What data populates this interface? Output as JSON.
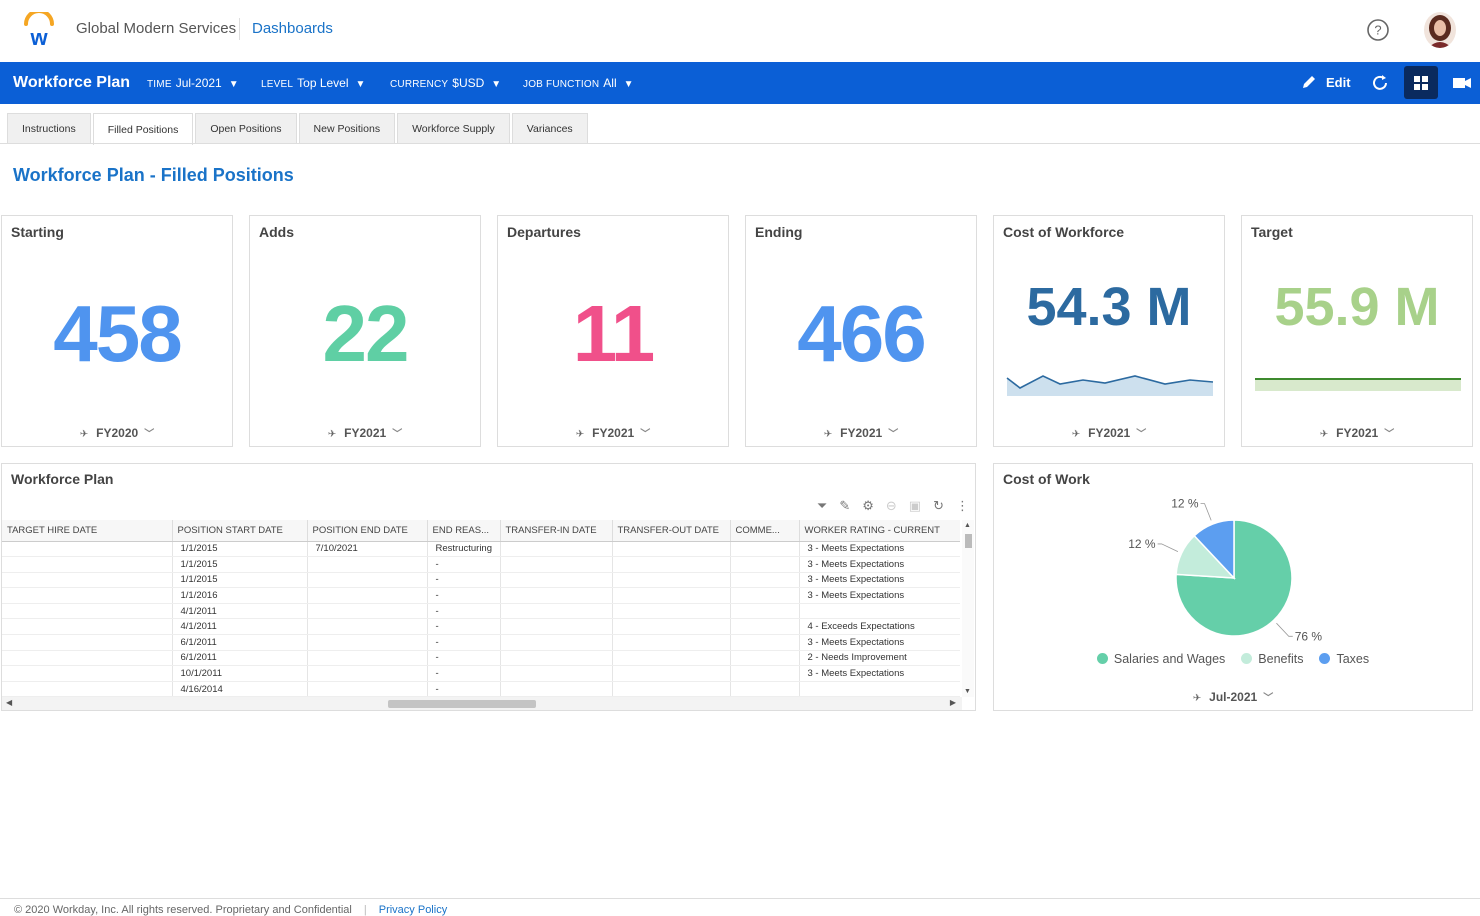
{
  "header": {
    "org_name": "Global Modern Services",
    "dashboards_link": "Dashboards"
  },
  "toolbar": {
    "title": "Workforce Plan",
    "prompts": [
      {
        "key": "TIME",
        "value": "Jul-2021"
      },
      {
        "key": "LEVEL",
        "value": "Top Level"
      },
      {
        "key": "CURRENCY",
        "value": "$USD"
      },
      {
        "key": "JOB FUNCTION",
        "value": "All"
      }
    ],
    "edit_label": "Edit"
  },
  "tabs": [
    "Instructions",
    "Filled Positions",
    "Open Positions",
    "New Positions",
    "Workforce Supply",
    "Variances"
  ],
  "active_tab": "Filled Positions",
  "page_title": "Workforce Plan - Filled Positions",
  "kpis": [
    {
      "title": "Starting",
      "value": "458",
      "period": "FY2020",
      "color": "#4f94ef"
    },
    {
      "title": "Adds",
      "value": "22",
      "period": "FY2021",
      "color": "#5fcfa4"
    },
    {
      "title": "Departures",
      "value": "11",
      "period": "FY2021",
      "color": "#f0508a"
    },
    {
      "title": "Ending",
      "value": "466",
      "period": "FY2021",
      "color": "#4f94ef"
    },
    {
      "title": "Cost of Workforce",
      "value": "54.3 M",
      "period": "FY2021",
      "color": "#2c6aa0"
    },
    {
      "title": "Target",
      "value": "55.9 M",
      "period": "FY2021",
      "color": "#a8d18a"
    }
  ],
  "workforce_plan": {
    "title": "Workforce Plan",
    "columns": [
      "TARGET HIRE DATE",
      "POSITION START DATE",
      "POSITION END DATE",
      "END REAS...",
      "TRANSFER-IN DATE",
      "TRANSFER-OUT DATE",
      "COMME...",
      "WORKER RATING - CURRENT"
    ],
    "rows": [
      [
        "",
        "1/1/2015",
        "7/10/2021",
        "Restructuring",
        "",
        "",
        "",
        "3 - Meets Expectations"
      ],
      [
        "",
        "1/1/2015",
        "",
        "-",
        "",
        "",
        "",
        "3 - Meets Expectations"
      ],
      [
        "",
        "1/1/2015",
        "",
        "-",
        "",
        "",
        "",
        "3 - Meets Expectations"
      ],
      [
        "",
        "1/1/2016",
        "",
        "-",
        "",
        "",
        "",
        "3 - Meets Expectations"
      ],
      [
        "",
        "4/1/2011",
        "",
        "-",
        "",
        "",
        "",
        ""
      ],
      [
        "",
        "4/1/2011",
        "",
        "-",
        "",
        "",
        "",
        "4 - Exceeds Expectations"
      ],
      [
        "",
        "6/1/2011",
        "",
        "-",
        "",
        "",
        "",
        "3 - Meets Expectations"
      ],
      [
        "",
        "6/1/2011",
        "",
        "-",
        "",
        "",
        "",
        "2 - Needs Improvement"
      ],
      [
        "",
        "10/1/2011",
        "",
        "-",
        "",
        "",
        "",
        "3 - Meets Expectations"
      ],
      [
        "",
        "4/16/2014",
        "",
        "-",
        "",
        "",
        "",
        ""
      ]
    ]
  },
  "cost_of_work": {
    "title": "Cost of Work",
    "period": "Jul-2021"
  },
  "chart_data": {
    "type": "pie",
    "title": "Cost of Work",
    "categories": [
      "Salaries and Wages",
      "Benefits",
      "Taxes"
    ],
    "values": [
      76,
      12,
      12
    ],
    "labels": [
      "76 %",
      "12 %",
      "12 %"
    ],
    "colors": [
      "#65cfa9",
      "#c3ecdb",
      "#5c9ef0"
    ],
    "legend": "bottom"
  },
  "footer": {
    "copyright": "© 2020 Workday, Inc. All rights reserved. Proprietary and Confidential",
    "privacy": "Privacy Policy"
  },
  "colors": {
    "brand_blue": "#0b5fd6",
    "link_blue": "#1a73c8"
  }
}
